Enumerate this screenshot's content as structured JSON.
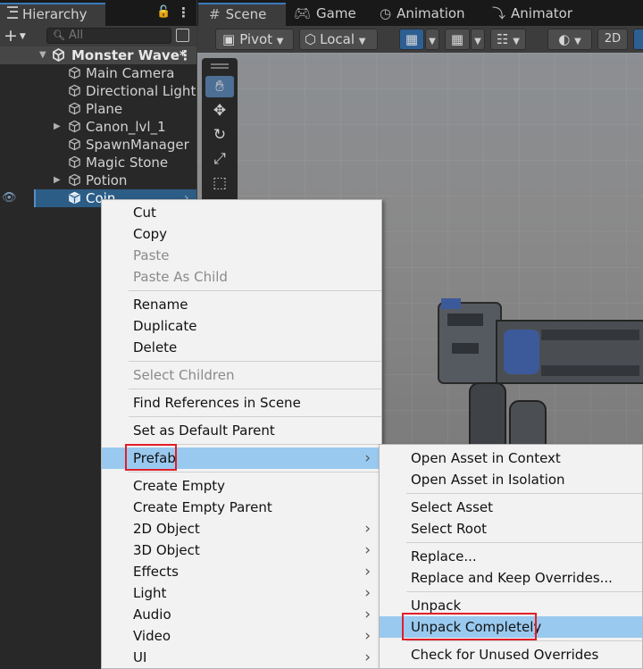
{
  "hierarchy": {
    "tab_label": "Hierarchy",
    "search_placeholder": "All",
    "scene_name": "Monster Wave*",
    "items": [
      {
        "label": "Main Camera",
        "expandable": false
      },
      {
        "label": "Directional Light",
        "expandable": false
      },
      {
        "label": "Plane",
        "expandable": false
      },
      {
        "label": "Canon_lvl_1",
        "expandable": true
      },
      {
        "label": "SpawnManager",
        "expandable": false
      },
      {
        "label": "Magic Stone",
        "expandable": false
      },
      {
        "label": "Potion",
        "expandable": true
      },
      {
        "label": "Coin",
        "expandable": false,
        "selected": true
      }
    ]
  },
  "scene_tabs": [
    {
      "label": "Scene",
      "active": true
    },
    {
      "label": "Game",
      "active": false
    },
    {
      "label": "Animation",
      "active": false
    },
    {
      "label": "Animator",
      "active": false
    }
  ],
  "scene_toolbar": {
    "pivot_label": "Pivot",
    "local_label": "Local",
    "mode_2d_label": "2D"
  },
  "context_menu": {
    "items": [
      {
        "label": "Cut",
        "disabled": false
      },
      {
        "label": "Copy",
        "disabled": false
      },
      {
        "label": "Paste",
        "disabled": true
      },
      {
        "label": "Paste As Child",
        "disabled": true
      },
      {
        "label": "Rename",
        "disabled": false
      },
      {
        "label": "Duplicate",
        "disabled": false
      },
      {
        "label": "Delete",
        "disabled": false
      },
      {
        "label": "Select Children",
        "disabled": true
      },
      {
        "label": "Find References in Scene",
        "disabled": false
      },
      {
        "label": "Set as Default Parent",
        "disabled": false
      },
      {
        "label": "Prefab",
        "disabled": false,
        "submenu": true,
        "highlighted": true
      },
      {
        "label": "Create Empty",
        "disabled": false
      },
      {
        "label": "Create Empty Parent",
        "disabled": false
      },
      {
        "label": "2D Object",
        "disabled": false,
        "submenu": true
      },
      {
        "label": "3D Object",
        "disabled": false,
        "submenu": true
      },
      {
        "label": "Effects",
        "disabled": false,
        "submenu": true
      },
      {
        "label": "Light",
        "disabled": false,
        "submenu": true
      },
      {
        "label": "Audio",
        "disabled": false,
        "submenu": true
      },
      {
        "label": "Video",
        "disabled": false,
        "submenu": true
      },
      {
        "label": "UI",
        "disabled": false,
        "submenu": true
      }
    ]
  },
  "prefab_submenu": {
    "items": [
      {
        "label": "Open Asset in Context"
      },
      {
        "label": "Open Asset in Isolation"
      },
      {
        "label": "Select Asset"
      },
      {
        "label": "Select Root"
      },
      {
        "label": "Replace..."
      },
      {
        "label": "Replace and Keep Overrides..."
      },
      {
        "label": "Unpack"
      },
      {
        "label": "Unpack Completely",
        "highlighted": true
      },
      {
        "label": "Check for Unused Overrides"
      }
    ]
  },
  "colors": {
    "selection_blue": "#2c5d87",
    "menu_highlight": "#99c9ef",
    "annotation_red": "#e0202a",
    "accent_tab": "#3a79bb"
  }
}
